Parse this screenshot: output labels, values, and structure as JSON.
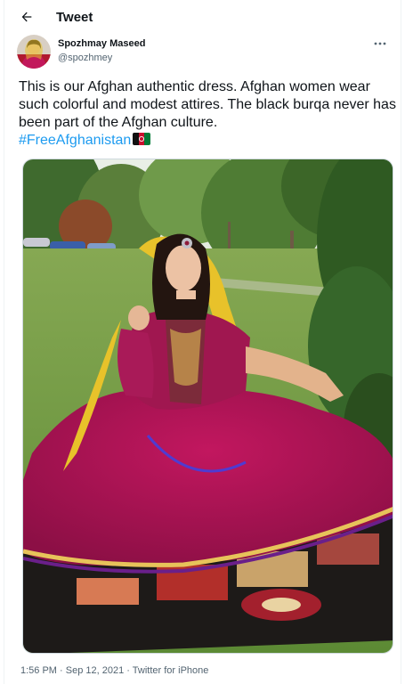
{
  "header": {
    "title": "Tweet",
    "back_icon": "arrow-left-icon"
  },
  "author": {
    "display_name": "Spozhmay Maseed",
    "handle": "@spozhmey",
    "more_icon": "ellipsis-icon"
  },
  "tweet": {
    "text": "This is our Afghan authentic dress. Afghan women wear such colorful and modest attires. The black burqa never has been part of the Afghan culture.",
    "hashtag": "#FreeAfghanistan",
    "emoji": "afghanistan-flag-icon"
  },
  "meta": {
    "time": "1:56 PM",
    "separator1": " · ",
    "date": "Sep 12, 2021",
    "separator2": " · ",
    "source": "Twitter for iPhone"
  },
  "colors": {
    "accent": "#1d9bf0",
    "muted": "#536471",
    "text": "#0f1419"
  }
}
